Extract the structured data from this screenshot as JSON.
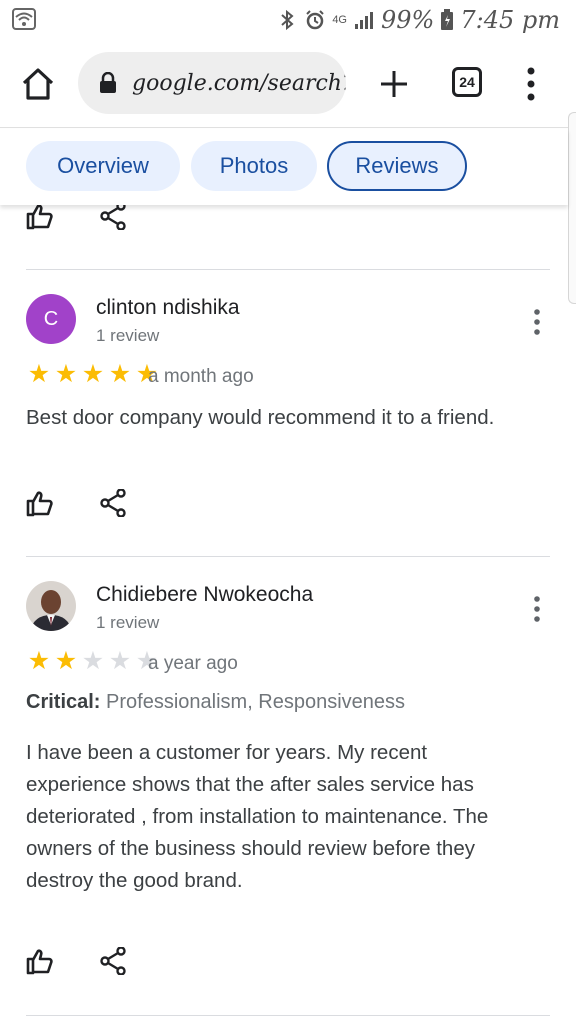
{
  "status_bar": {
    "battery": "99%",
    "time": "7:45 pm",
    "network": "4G"
  },
  "browser": {
    "url": "google.com/search?q",
    "tab_count": "24"
  },
  "chips": [
    {
      "label": "Overview",
      "active": false
    },
    {
      "label": "Photos",
      "active": false
    },
    {
      "label": "Reviews",
      "active": true
    }
  ],
  "reviews": [
    {
      "avatar_letter": "C",
      "name": "clinton ndishika",
      "count": "1 review",
      "rating": 5,
      "date": "a month ago",
      "text": "Best door company would recommend it to a friend."
    },
    {
      "name": "Chidiebere Nwokeocha",
      "count": "1 review",
      "rating": 2,
      "date": "a year ago",
      "critical_label": "Critical:",
      "critical_value": "Professionalism, Responsiveness",
      "text": "I have been a customer for years. My recent experience shows that the after sales service has deteriorated , from installation to maintenance.  The owners of the business should review before they destroy the good brand."
    }
  ],
  "colors": {
    "chip_text": "#1a4fa0",
    "chip_bg": "#e8f0fe",
    "star_on": "#fbbc04",
    "star_off": "#dadce0",
    "avatar_bg": "#a142c9"
  }
}
